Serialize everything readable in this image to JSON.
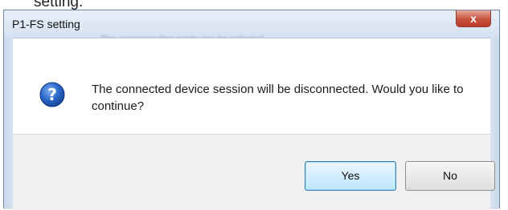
{
  "background": {
    "fragment_text": "setting."
  },
  "dialog": {
    "title": "P1-FS setting",
    "blurred_text": "The corresponding mode can be selected",
    "close_glyph": "x",
    "icon": "question-icon",
    "message": "The connected device session will be disconnected. Would you like to continue?",
    "buttons": {
      "yes": "Yes",
      "no": "No"
    }
  },
  "colors": {
    "title_bar": "#d6e2f1",
    "close_button": "#c8513f",
    "icon_blue": "#1f57b8",
    "default_button_border": "#3c7fb1",
    "footer": "#f0f0f0"
  }
}
